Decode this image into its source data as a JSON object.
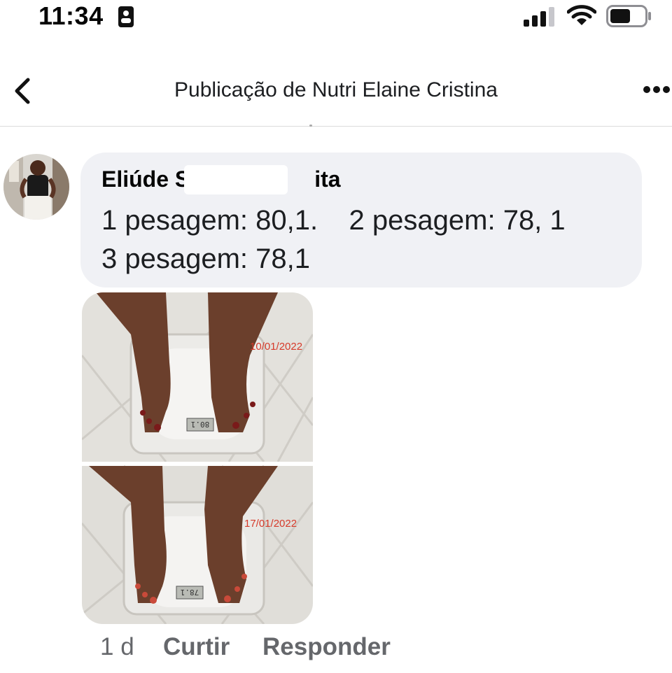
{
  "status_bar": {
    "time": "11:34",
    "icons": [
      "id-card-icon",
      "signal-icon",
      "wifi-icon",
      "battery-icon"
    ]
  },
  "header": {
    "title": "Publicação de Nutri Elaine Cristina",
    "back_icon": "chevron-left-icon",
    "more_icon": "more-horizontal-icon"
  },
  "comment": {
    "author_visible": "Eliúde S",
    "author_tail": "ita",
    "line1": "1 pesagem: 80,1.    2 pesagem: 78, 1",
    "line2": "3 pesagem: 78,1",
    "photo": {
      "top_date": "10/01/2022",
      "bottom_date": "17/01/2022",
      "top_display": "80.1",
      "bottom_display": "78.1"
    },
    "actions": {
      "age": "1 d",
      "like": "Curtir",
      "reply": "Responder"
    }
  },
  "colors": {
    "bubble": "#f0f1f5",
    "secondary_text": "#65676b",
    "date_stamp": "#d63a2a",
    "skin": "#6b3f2c",
    "floor": "#e2e0dc"
  }
}
